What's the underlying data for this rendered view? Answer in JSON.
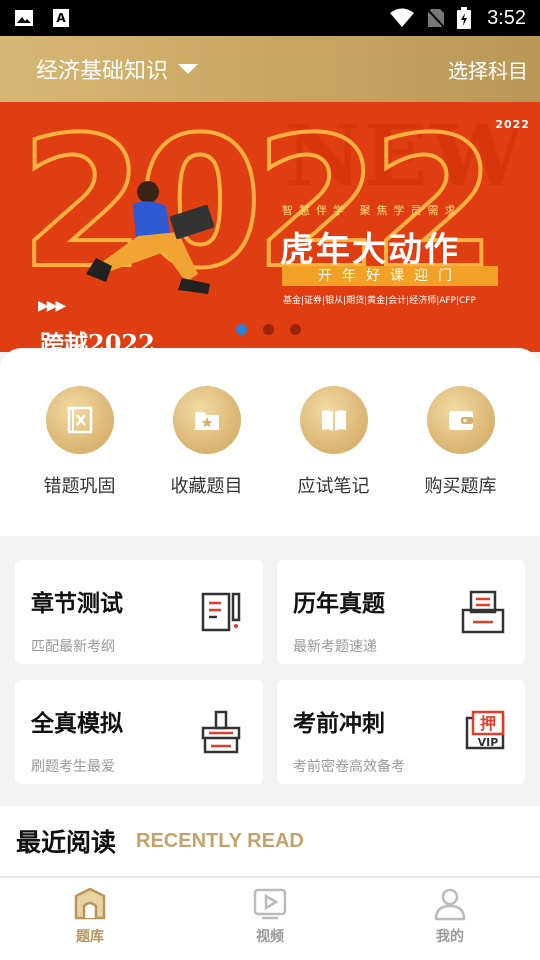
{
  "statusbar": {
    "time": "3:52",
    "icons": [
      "image-icon",
      "font-icon",
      "wifi-icon",
      "no-sim-icon",
      "battery-charging-icon"
    ]
  },
  "header": {
    "subject": "经济基础知识",
    "choose_subject": "选择科目"
  },
  "banner": {
    "new_word": "NEW",
    "year_small": "2022",
    "big_year": "2022",
    "tagline": "智慧伴学 聚焦学员需求",
    "headline": "虎年大动作",
    "pill": "开年好课迎门",
    "subjects": "基金|证券|银从|期货|黄金|会计|经济师|AFP|CFP",
    "cross": "跨越2022",
    "arrows": "▶▶▶",
    "slide_count": 3,
    "active_slide": 1
  },
  "quick_actions": [
    {
      "label": "错题巩固",
      "icon": "wrong-questions-icon"
    },
    {
      "label": "收藏题目",
      "icon": "favorites-folder-icon"
    },
    {
      "label": "应试笔记",
      "icon": "notebook-icon"
    },
    {
      "label": "购买题库",
      "icon": "wallet-icon"
    }
  ],
  "cards": [
    {
      "title": "章节测试",
      "desc": "匹配最新考纲",
      "icon": "chapter-test-icon"
    },
    {
      "title": "历年真题",
      "desc": "最新考题速递",
      "icon": "past-papers-icon"
    },
    {
      "title": "全真模拟",
      "desc": "刷题考生最爱",
      "icon": "mock-exam-icon"
    },
    {
      "title": "考前冲刺",
      "desc": "考前密卷高效备考",
      "icon": "vip-sprint-icon",
      "badge_char": "押",
      "badge_text": "VIP"
    }
  ],
  "recent": {
    "title": "最近阅读",
    "title_en": "RECENTLY READ"
  },
  "tabs": [
    {
      "label": "题库",
      "icon": "question-bank-icon",
      "active": true
    },
    {
      "label": "视频",
      "icon": "video-icon",
      "active": false
    },
    {
      "label": "我的",
      "icon": "profile-icon",
      "active": false
    }
  ],
  "colors": {
    "gold": "#c8a55f",
    "banner_red": "#e13d12",
    "accent_text": "#c4a269",
    "dot_active": "#2a82d8"
  }
}
